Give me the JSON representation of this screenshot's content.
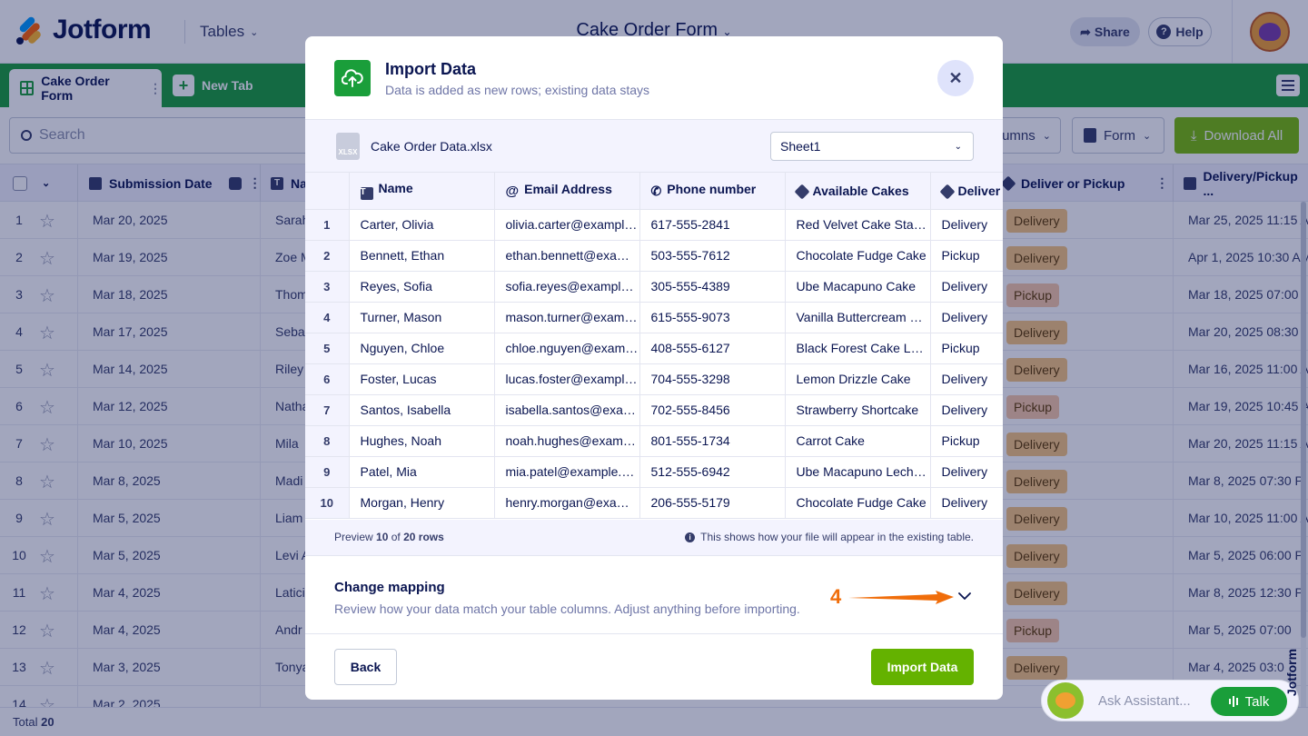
{
  "app": {
    "brand": "Jotform",
    "tables_label": "Tables",
    "title": "Cake Order Form"
  },
  "header": {
    "share_label": "Share",
    "help_label": "Help"
  },
  "tabs": {
    "active": "Cake Order Form",
    "new_tab": "New Tab"
  },
  "toolbar": {
    "search_placeholder": "Search",
    "columns_label": "umns",
    "form_label": "Form",
    "download_label": "Download All"
  },
  "grid": {
    "headers": {
      "submission_date": "Submission Date",
      "name_partial": "Na",
      "deliver_or_pickup": "Deliver or Pickup",
      "delivery_pickup": "Delivery/Pickup ..."
    },
    "rows": [
      {
        "num": "1",
        "date": "Mar 20, 2025",
        "name": "Sarah",
        "status": "Delivery",
        "ddate": "Mar 25, 2025 11:15 A"
      },
      {
        "num": "2",
        "date": "Mar 19, 2025",
        "name": "Zoe M",
        "status": "Delivery",
        "ddate": "Apr 1, 2025 10:30 AM"
      },
      {
        "num": "3",
        "date": "Mar 18, 2025",
        "name": "Thom",
        "status": "Pickup",
        "ddate": "Mar 18, 2025 07:00"
      },
      {
        "num": "4",
        "date": "Mar 17, 2025",
        "name": "Seba",
        "status": "Delivery",
        "ddate": "Mar 20, 2025 08:30"
      },
      {
        "num": "5",
        "date": "Mar 14, 2025",
        "name": "Riley",
        "status": "Delivery",
        "ddate": "Mar 16, 2025 11:00 A"
      },
      {
        "num": "6",
        "date": "Mar 12, 2025",
        "name": "Natha",
        "status": "Pickup",
        "ddate": "Mar 19, 2025 10:45 A"
      },
      {
        "num": "7",
        "date": "Mar 10, 2025",
        "name": "Mila",
        "status": "Delivery",
        "ddate": "Mar 20, 2025 11:15 A"
      },
      {
        "num": "8",
        "date": "Mar 8, 2025",
        "name": "Madi",
        "status": "Delivery",
        "ddate": "Mar 8, 2025 07:30 P"
      },
      {
        "num": "9",
        "date": "Mar 5, 2025",
        "name": "Liam",
        "status": "Delivery",
        "ddate": "Mar 10, 2025 11:00 A"
      },
      {
        "num": "10",
        "date": "Mar 5, 2025",
        "name": "Levi A",
        "status": "Delivery",
        "ddate": "Mar 5, 2025 06:00 P"
      },
      {
        "num": "11",
        "date": "Mar 4, 2025",
        "name": "Latici",
        "status": "Delivery",
        "ddate": "Mar 8, 2025 12:30 P"
      },
      {
        "num": "12",
        "date": "Mar 4, 2025",
        "name": "Andr",
        "status": "Pickup",
        "ddate": "Mar 5, 2025 07:00"
      },
      {
        "num": "13",
        "date": "Mar 3, 2025",
        "name": "Tonya",
        "status": "Delivery",
        "ddate": "Mar 4, 2025 03:0"
      },
      {
        "num": "14",
        "date": "Mar 2, 2025",
        "name": "",
        "status": "",
        "ddate": ""
      }
    ],
    "total_label": "Total",
    "total_value": "20"
  },
  "modal": {
    "title": "Import Data",
    "subtitle": "Data is added as new rows; existing data stays",
    "file_name": "Cake Order Data.xlsx",
    "file_type": "XLSX",
    "sheet": "Sheet1",
    "columns": [
      "Name",
      "Email Address",
      "Phone number",
      "Available Cakes",
      "Deliver"
    ],
    "rows": [
      [
        "1",
        "Carter, Olivia",
        "olivia.carter@example.com",
        "617-555-2841",
        "Red Velvet Cake Standard",
        "Delivery"
      ],
      [
        "2",
        "Bennett, Ethan",
        "ethan.bennett@example.com",
        "503-555-7612",
        "Chocolate Fudge Cake",
        "Pickup"
      ],
      [
        "3",
        "Reyes, Sofia",
        "sofia.reyes@example.com",
        "305-555-4389",
        "Ube Macapuno Cake",
        "Delivery"
      ],
      [
        "4",
        "Turner, Mason",
        "mason.turner@example.com",
        "615-555-9073",
        "Vanilla Buttercream Cake",
        "Delivery"
      ],
      [
        "5",
        "Nguyen, Chloe",
        "chloe.nguyen@example.com",
        "408-555-6127",
        "Black Forest Cake Large",
        "Pickup"
      ],
      [
        "6",
        "Foster, Lucas",
        "lucas.foster@example.com",
        "704-555-3298",
        "Lemon Drizzle Cake",
        "Delivery"
      ],
      [
        "7",
        "Santos, Isabella",
        "isabella.santos@example.com",
        "702-555-8456",
        "Strawberry Shortcake",
        "Delivery"
      ],
      [
        "8",
        "Hughes, Noah",
        "noah.hughes@example.com",
        "801-555-1734",
        "Carrot Cake",
        "Pickup"
      ],
      [
        "9",
        "Patel, Mia",
        "mia.patel@example.com",
        "512-555-6942",
        "Ube Macapuno Leche Flan",
        "Delivery"
      ],
      [
        "10",
        "Morgan, Henry",
        "henry.morgan@example.com",
        "206-555-5179",
        "Chocolate Fudge Cake",
        "Delivery"
      ]
    ],
    "preview_prefix": "Preview",
    "preview_shown": "10",
    "preview_of": "of",
    "preview_total": "20 rows",
    "preview_note": "This shows how your file will appear in the existing table.",
    "mapping_title": "Change mapping",
    "mapping_desc": "Review how your data match your table columns. Adjust anything before importing.",
    "annotation_number": "4",
    "back_label": "Back",
    "import_label": "Import Data"
  },
  "assistant": {
    "placeholder": "Ask Assistant...",
    "talk_label": "Talk",
    "badge_text": "Jotform"
  },
  "colors": {
    "green": "#1a9e3a",
    "import_green": "#64b200",
    "annotation": "#f06d0a",
    "navy": "#0a1551"
  }
}
